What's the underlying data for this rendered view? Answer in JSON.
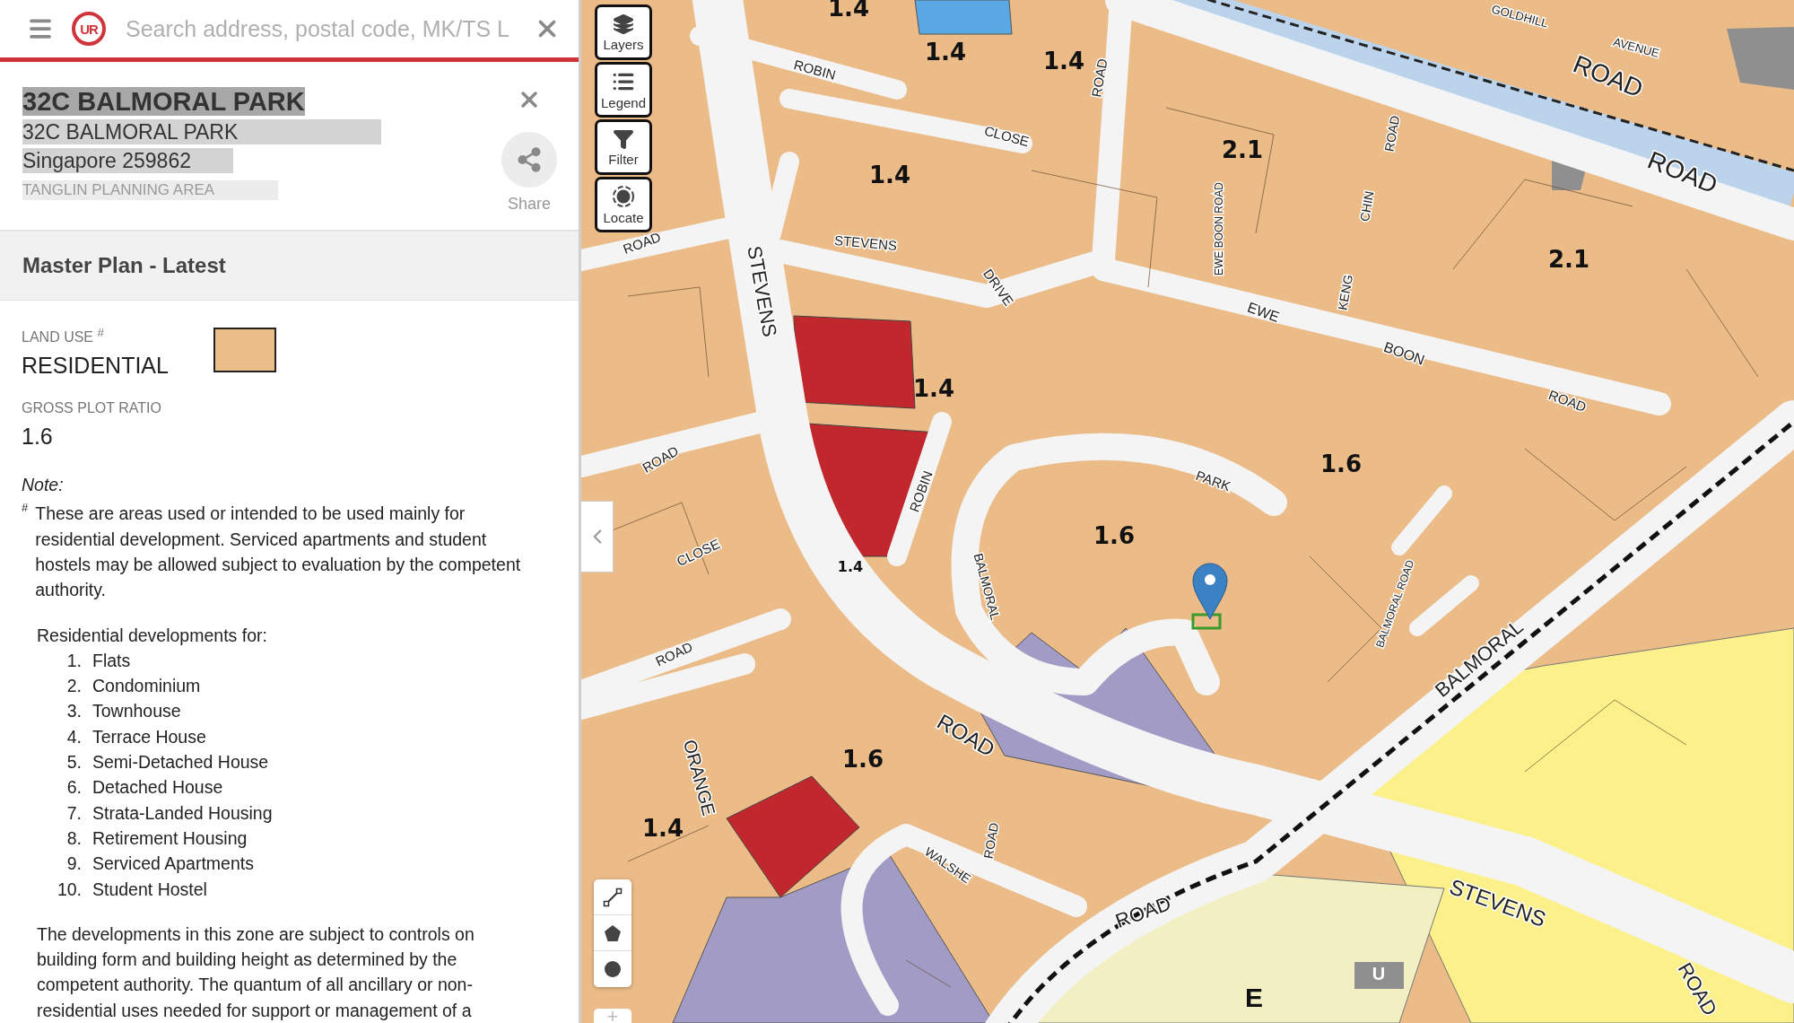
{
  "search": {
    "placeholder": "Search address, postal code, MK/TS L"
  },
  "logo_text": "UR",
  "place": {
    "title": "32C BALMORAL PARK",
    "address_lines": [
      "32C BALMORAL PARK",
      "Singapore 259862"
    ],
    "planning_area": "TANGLIN PLANNING AREA",
    "share_label": "Share"
  },
  "section_title": "Master Plan - Latest",
  "land_use": {
    "label": "LAND USE $^{#}$",
    "value": "RESIDENTIAL"
  },
  "gross_plot_ratio": {
    "label": "GROSS PLOT RATIO",
    "value": "1.6"
  },
  "note": {
    "label": "Note:",
    "mark": "#",
    "paragraph": "These are areas used or intended to be used mainly for residential development. Serviced apartments and student hostels may be allowed subject to evaluation by the competent authority.",
    "list_intro": "Residential developments for:",
    "list": [
      {
        "number": "1.",
        "text": "Flats"
      },
      {
        "number": "2.",
        "text": "Condominium"
      },
      {
        "number": "3.",
        "text": "Townhouse"
      },
      {
        "number": "4.",
        "text": "Terrace House"
      },
      {
        "number": "5.",
        "text": "Semi-Detached House"
      },
      {
        "number": "6.",
        "text": "Detached House"
      },
      {
        "number": "7.",
        "text": "Strata-Landed Housing"
      },
      {
        "number": "8.",
        "text": "Retirement Housing"
      },
      {
        "number": "9.",
        "text": "Serviced Apartments"
      },
      {
        "number": "10.",
        "text": "Student Hostel"
      }
    ],
    "closing": "The developments in this zone are subject to controls on building form and building height as determined by the competent authority. The quantum of all ancillary or non-residential uses needed for support or management of a"
  },
  "map_controls": [
    {
      "kind": "layers",
      "label": "Layers"
    },
    {
      "kind": "legend",
      "label": "Legend"
    },
    {
      "kind": "filter",
      "label": "Filter"
    },
    {
      "kind": "locate",
      "label": "Locate"
    }
  ],
  "zoom_in": "+",
  "map_labels": {
    "plot_ratios": [
      "1.4",
      "1.4",
      "1.4",
      "1.4",
      "2.1",
      "2.1",
      "1.4",
      "1.6",
      "1.6",
      "1.4",
      "1.6",
      "1.4"
    ],
    "zones": [
      "E",
      "U"
    ],
    "streets": [
      "ROAD",
      "ROAD",
      "GOLDHILL",
      "AVENUE",
      "ROBIN",
      "CLOSE",
      "ROAD",
      "STEVENS",
      "STEVENS",
      "DRIVE",
      "ROAD",
      "ROAD",
      "CLOSE",
      "ROAD",
      "ROBIN",
      "PARK",
      "BALMORAL",
      "ROAD",
      "ORANGE",
      "WALSHE",
      "ROAD",
      "ROAD",
      "STEVENS",
      "BALMORAL",
      "EWE BOON ROAD",
      "CHIN",
      "KENG",
      "ROAD",
      "EWE",
      "BOON",
      "ROAD",
      "BALMORAL ROAD",
      "ROAD"
    ]
  }
}
